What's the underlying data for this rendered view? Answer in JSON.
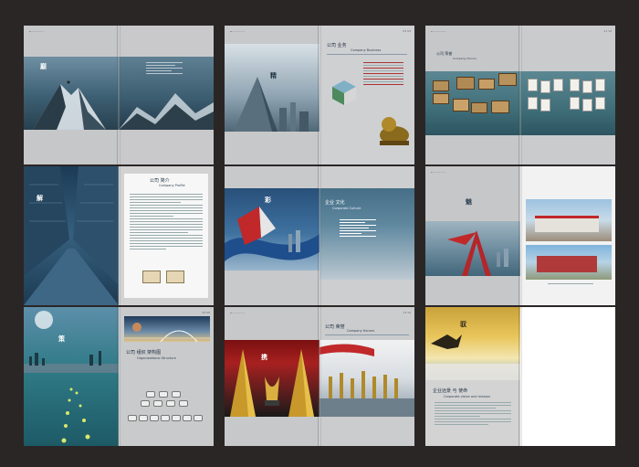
{
  "colors": {
    "background": "#2b2626",
    "page_grey": "#c9c9cb",
    "teal": "#4a7a86",
    "navy": "#1f3447",
    "red": "#c0282a"
  },
  "spreads": [
    {
      "name": "mountain-cover",
      "en": "",
      "cn": ""
    },
    {
      "name": "company-business",
      "en": "Company Business",
      "cn": "公司 业务"
    },
    {
      "name": "company-honors-1",
      "en": "Company Honors",
      "cn": "公司 荣誉"
    },
    {
      "name": "company-profile",
      "en": "Company Profile",
      "cn": "公司 简介"
    },
    {
      "name": "corporate-culture",
      "en": "Corporate Culture",
      "cn": "企业 文化"
    },
    {
      "name": "facility-photos",
      "en": "",
      "cn": ""
    },
    {
      "name": "organizational-structure",
      "en": "Organizational Structure",
      "cn": "公司 组织 架构图"
    },
    {
      "name": "company-honors-2",
      "en": "Company Honors",
      "cn": "公司 荣誉"
    },
    {
      "name": "vision-mission",
      "en": "Corporate vision and mission",
      "cn": "企业远景 与 使命"
    }
  ]
}
